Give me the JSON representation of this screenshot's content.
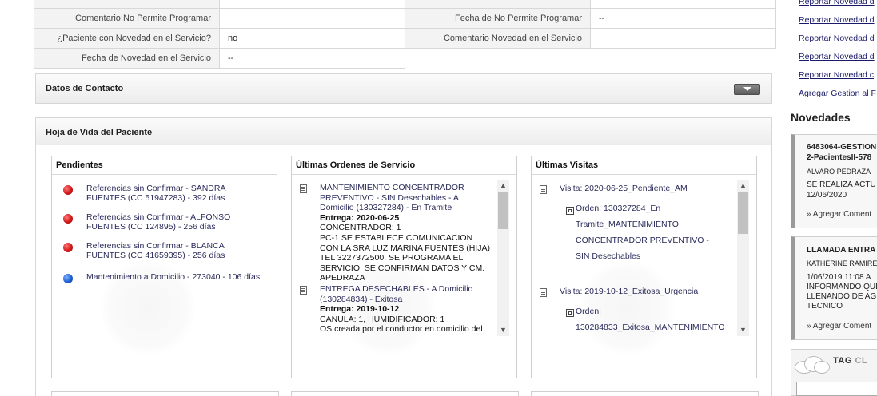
{
  "form_rows": [
    {
      "label1": "Comentario No Permite Programar",
      "value1": "",
      "label2": "Fecha de No Permite Programar",
      "value2": "--"
    },
    {
      "label1": "¿Paciente con Novedad en el Servicio?",
      "value1": "no",
      "label2": "Comentario Novedad en el Servicio",
      "value2": ""
    },
    {
      "label1": "Fecha de Novedad en el Servicio",
      "value1": "--"
    }
  ],
  "contact_panel": {
    "title": "Datos de Contacto"
  },
  "hv_panel": {
    "title": "Hoja de Vida del Paciente"
  },
  "pendientes": {
    "title": "Pendientes",
    "items": [
      {
        "text": "Referencias sin Confirmar - SANDRA FUENTES (CC 51947283) - 392 días",
        "status": "red"
      },
      {
        "text": "Referencias sin Confirmar - ALFONSO FUENTES (CC 124895) - 256 días",
        "status": "red"
      },
      {
        "text": "Referencias sin Confirmar - BLANCA FUENTES (CC 41659395) - 256 días",
        "status": "red"
      },
      {
        "text": "Mantenimiento a Domicilio - 273040 - 106 días",
        "status": "blue"
      }
    ]
  },
  "ordenes": {
    "title": "Últimas Ordenes de Servicio",
    "entries": [
      {
        "head": "MANTENIMIENTO CONCENTRADOR PREVENTIVO - SIN Desechables - A Domicilio (130327284) - En Tramite",
        "entrega": "Entrega: 2020-06-25",
        "detail": "CONCENTRADOR: 1",
        "note": "PC-1 SE ESTABLECE COMUNICACION CON LA SRA LUZ MARINA FUENTES (HIJA) TEL 3227372500. SE PROGRAMA EL SERVICIO, SE CONFIRMAN DATOS Y CM. APEDRAZA"
      },
      {
        "head": "ENTREGA DESECHABLES - A Domicilio (130284834) - Exitosa",
        "entrega": "Entrega: 2019-10-12",
        "detail": "CANULA: 1, HUMIDIFICADOR: 1",
        "note": "OS creada por el conductor en domicilio del paciente"
      }
    ]
  },
  "visitas": {
    "title": "Últimas Visitas",
    "entries": [
      {
        "head": "Visita: 2020-06-25_Pendiente_AM",
        "order": "Orden: 130327284_En Tramite_MANTENIMIENTO CONCENTRADOR PREVENTIVO - SIN Desechables"
      },
      {
        "head": "Visita: 2019-10-12_Exitosa_Urgencia",
        "order": "Orden: 130284833_Exitosa_MANTENIMIENTO"
      }
    ]
  },
  "right": {
    "links": [
      "Reportar Novedad d",
      "Reportar Novedad d",
      "Reportar Novedad d",
      "Reportar Novedad d",
      "Reportar Novedad c",
      "Agregar Gestion al F"
    ],
    "novedades_title": "Novedades",
    "cards": [
      {
        "title1": "6483064-GESTION",
        "title2": "2-PacientesII-578",
        "author": "ALVARO PEDRAZA",
        "desc1": "SE REALIZA ACTU",
        "desc2": "12/06/2020",
        "comment": "» Agregar Coment"
      },
      {
        "title1": "LLAMADA ENTRA",
        "author": "KATHERINE RAMIRE",
        "desc1": "1/06/2019 11:08 A",
        "desc2": "INFORMANDO QUE",
        "desc3": "LLENANDO DE AG",
        "desc4": "TECNICO",
        "comment": "» Agregar Coment"
      }
    ],
    "tag": {
      "part1": "TAG",
      "part2": "CL"
    }
  }
}
